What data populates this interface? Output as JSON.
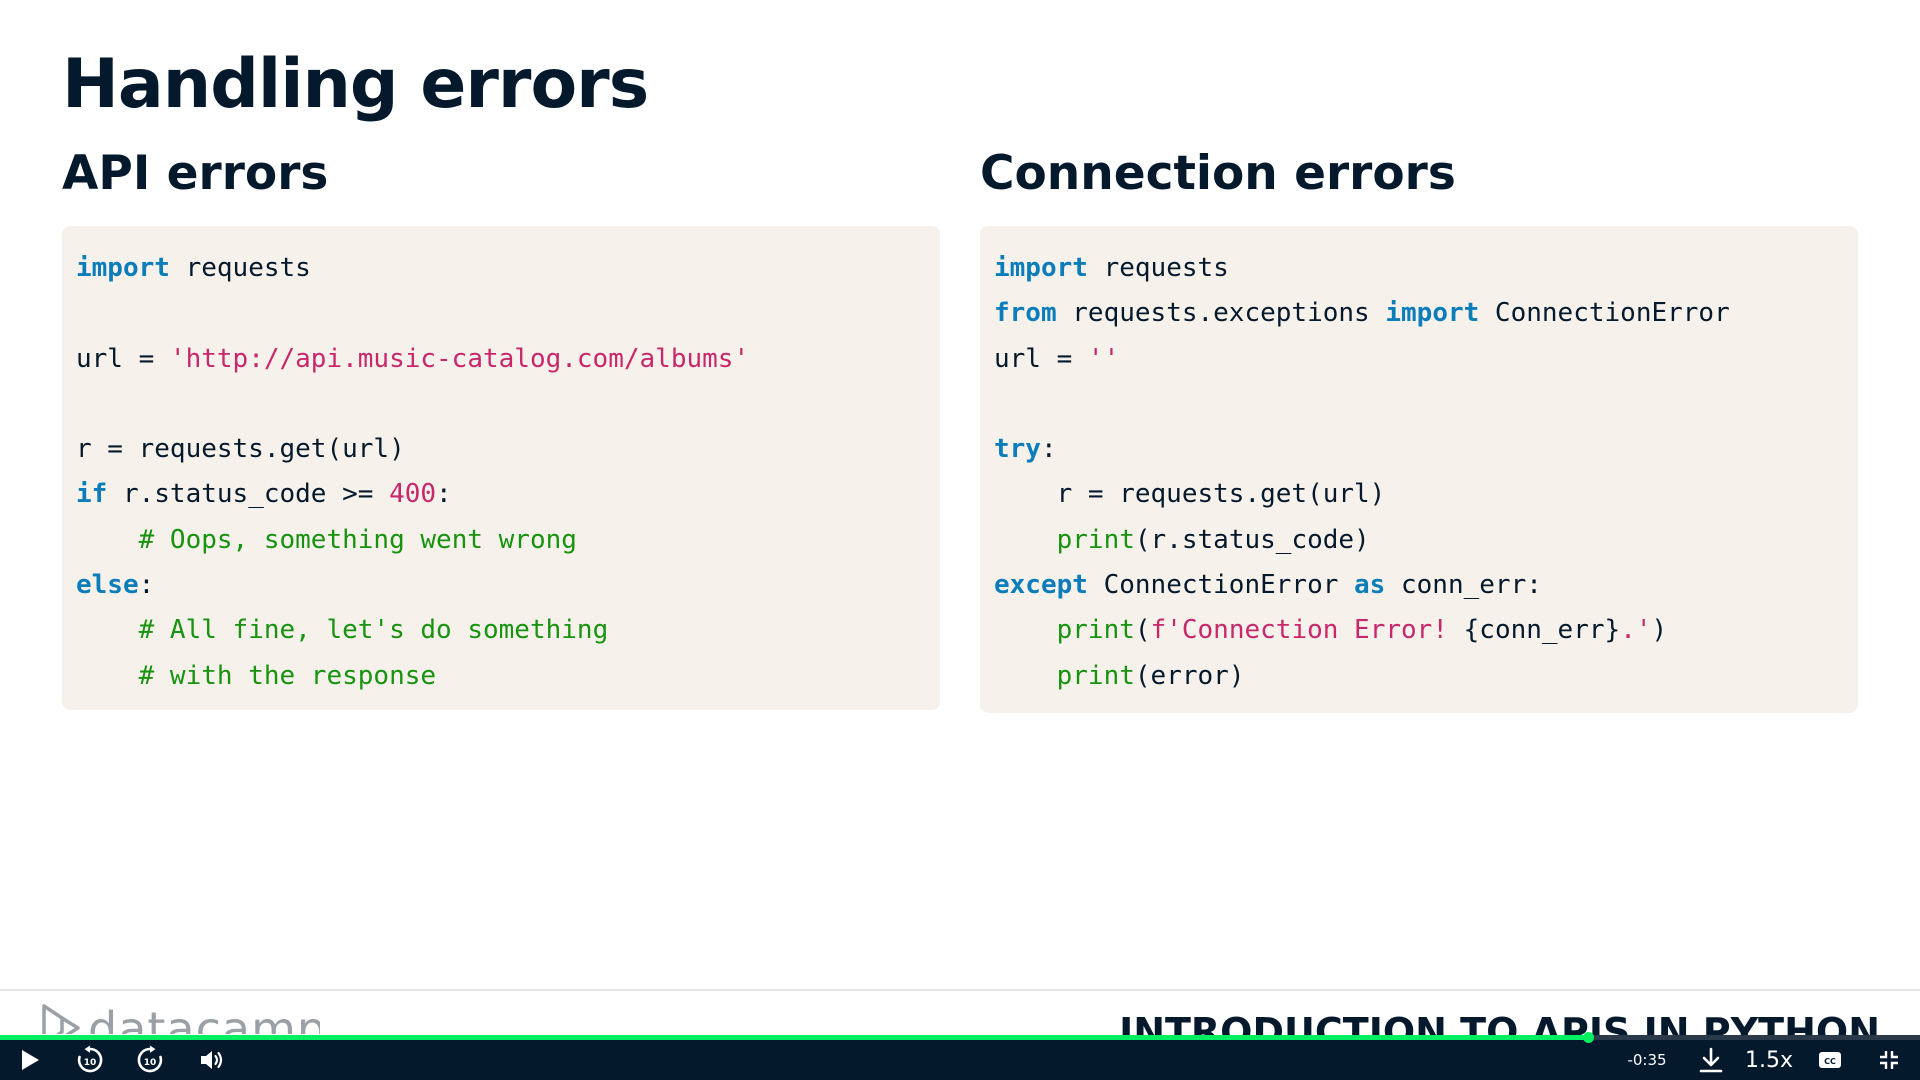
{
  "slide": {
    "title": "Handling errors",
    "left": {
      "heading": "API errors",
      "code": [
        [
          {
            "t": "import",
            "c": "kw"
          },
          {
            "t": " requests"
          }
        ],
        [],
        [
          {
            "t": "url = "
          },
          {
            "t": "'http://api.music-catalog.com/albums'",
            "c": "str"
          }
        ],
        [],
        [
          {
            "t": "r = requests.get(url)"
          }
        ],
        [
          {
            "t": "if",
            "c": "kw"
          },
          {
            "t": " r.status_code >= "
          },
          {
            "t": "400",
            "c": "num"
          },
          {
            "t": ":"
          }
        ],
        [
          {
            "t": "    "
          },
          {
            "t": "# Oops, something went wrong",
            "c": "cm"
          }
        ],
        [
          {
            "t": "else",
            "c": "kw"
          },
          {
            "t": ":"
          }
        ],
        [
          {
            "t": "    "
          },
          {
            "t": "# All fine, let's do something",
            "c": "cm"
          }
        ],
        [
          {
            "t": "    "
          },
          {
            "t": "# with the response",
            "c": "cm"
          }
        ]
      ]
    },
    "right": {
      "heading": "Connection errors",
      "code": [
        [
          {
            "t": "import",
            "c": "kw"
          },
          {
            "t": " requests"
          }
        ],
        [
          {
            "t": "from",
            "c": "kw"
          },
          {
            "t": " requests.exceptions "
          },
          {
            "t": "import",
            "c": "kw"
          },
          {
            "t": " ConnectionError"
          }
        ],
        [
          {
            "t": "url = "
          },
          {
            "t": "''",
            "c": "str"
          }
        ],
        [],
        [
          {
            "t": "try",
            "c": "kw"
          },
          {
            "t": ":"
          }
        ],
        [
          {
            "t": "    r = requests.get(url)"
          }
        ],
        [
          {
            "t": "    "
          },
          {
            "t": "print",
            "c": "fn"
          },
          {
            "t": "(r.status_code)"
          }
        ],
        [
          {
            "t": "except",
            "c": "kw"
          },
          {
            "t": " ConnectionError "
          },
          {
            "t": "as",
            "c": "kw"
          },
          {
            "t": " conn_err:"
          }
        ],
        [
          {
            "t": "    "
          },
          {
            "t": "print",
            "c": "fn"
          },
          {
            "t": "("
          },
          {
            "t": "f'Connection Error! ",
            "c": "str"
          },
          {
            "t": "{conn_err}"
          },
          {
            "t": ".'",
            "c": "str"
          },
          {
            "t": ")"
          }
        ],
        [
          {
            "t": "    "
          },
          {
            "t": "print",
            "c": "fn"
          },
          {
            "t": "(error)"
          }
        ]
      ]
    },
    "footer": {
      "brand": "datacamp",
      "course_title": "INTRODUCTION TO APIS IN PYTHON"
    }
  },
  "player": {
    "progress": 0.827,
    "time_remaining": "-0:35",
    "speed": "1.5x",
    "icons": {
      "play": "play-icon",
      "rewind": "rewind-10-icon",
      "forward": "forward-10-icon",
      "volume": "volume-icon",
      "download": "download-icon",
      "captions": "captions-icon",
      "fullscreen": "exit-fullscreen-icon"
    }
  },
  "colors": {
    "heading": "#05192d",
    "code_background": "#f6f2eb",
    "keyword": "#0b7dbb",
    "string": "#c9276b",
    "comment": "#18930f",
    "progress": "#03ef62",
    "player_background": "#05192d"
  }
}
